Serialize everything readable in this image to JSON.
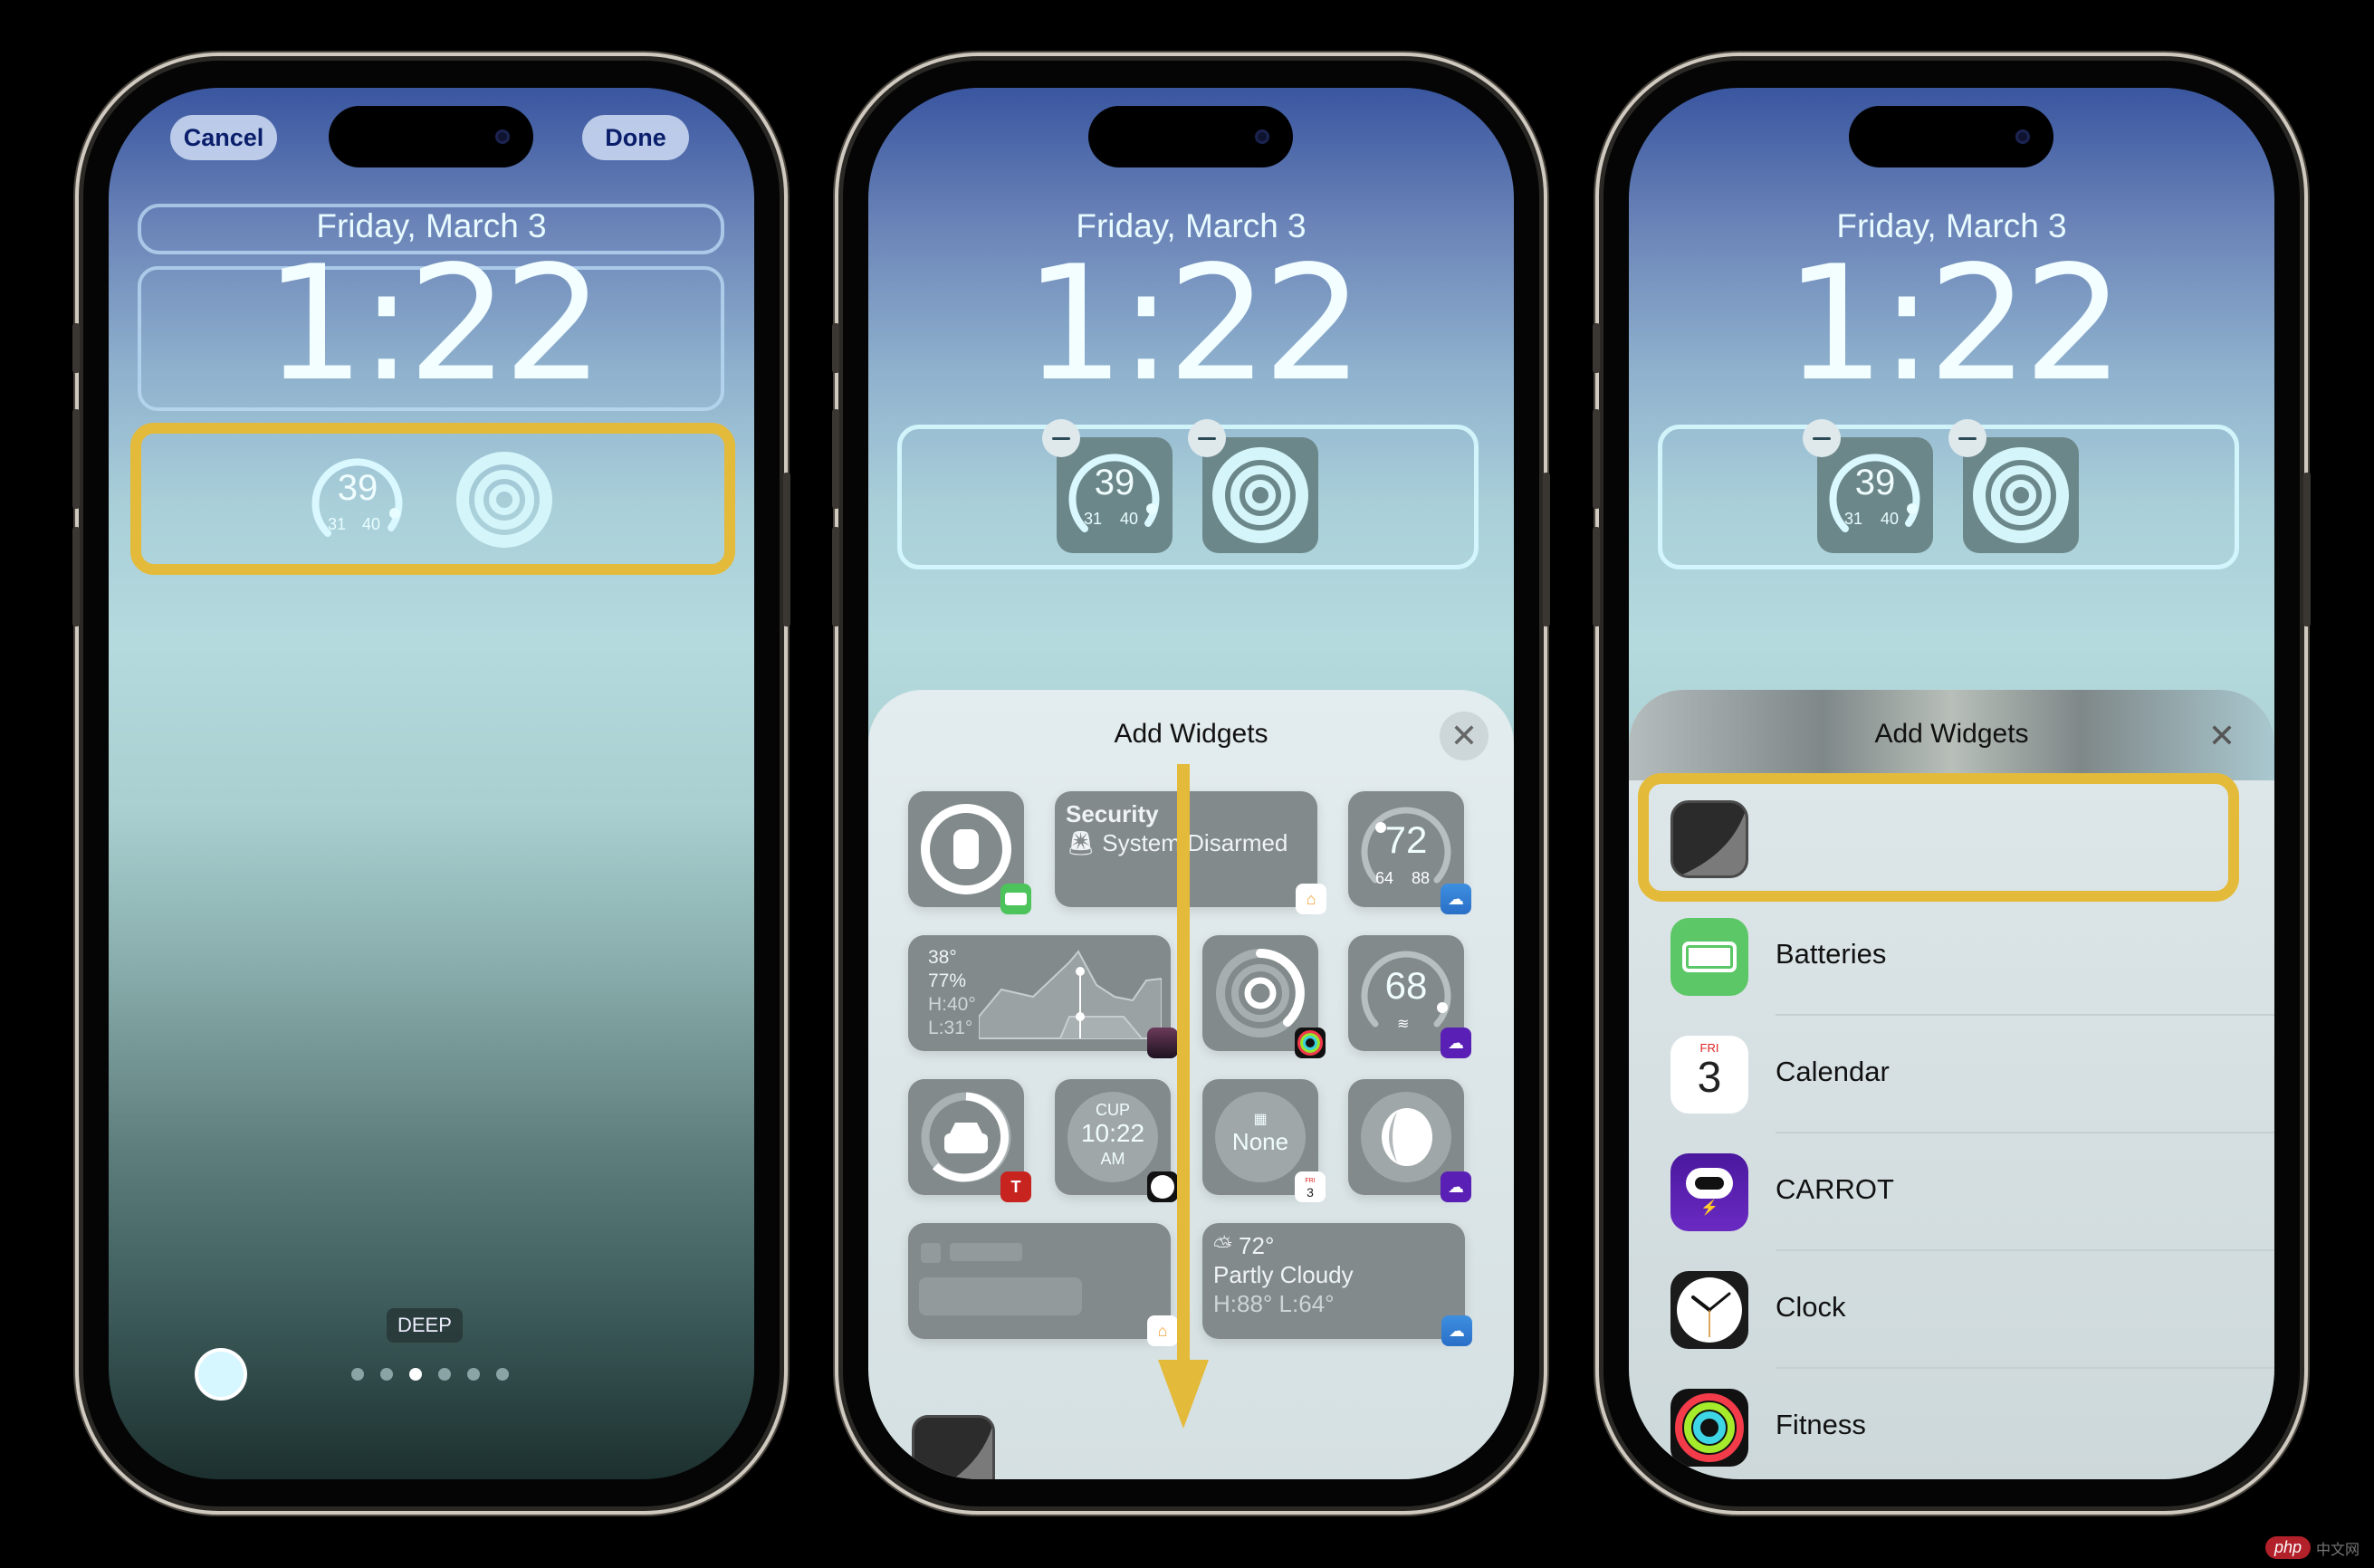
{
  "lockscreen": {
    "date": "Friday, March 3",
    "time": "1:22",
    "weather_gauge": {
      "current": "39",
      "low": "31",
      "high": "40"
    },
    "accent_highlight": "#e4ba3a"
  },
  "phone1": {
    "cancel_label": "Cancel",
    "done_label": "Done",
    "filter_label": "DEEP",
    "page_dots": {
      "count": 6,
      "active_index": 2
    }
  },
  "phone2": {
    "sheet_title": "Add Widgets",
    "close_icon": "close-icon",
    "widgets": {
      "battery": {
        "icon": "watch-icon",
        "app_badge": "batteries-badge"
      },
      "security": {
        "line1": "Security",
        "line2": "System Disarmed",
        "icon": "siren-icon",
        "app_badge": "home-badge"
      },
      "temp72": {
        "current": "72",
        "low": "64",
        "high": "88",
        "app_badge": "weather-badge"
      },
      "forecast": {
        "temp": "38°",
        "humidity": "77%",
        "high": "H:40°",
        "low": "L:31°",
        "app_badge": "photo-badge"
      },
      "activity": {
        "app_badge": "fitness-badge"
      },
      "wind68": {
        "current": "68",
        "app_badge": "carrot-badge"
      },
      "tesla": {
        "icon": "car-charging-icon",
        "app_badge": "tesla-badge"
      },
      "worldclock": {
        "city": "CUP",
        "time": "10:22",
        "ampm": "AM",
        "app_badge": "clock-badge"
      },
      "calendar": {
        "text": "None",
        "app_badge_day": "FRI",
        "app_badge_date": "3"
      },
      "moon": {
        "app_badge": "carrot-badge"
      },
      "home_placeholder": {
        "app_badge": "home-badge"
      },
      "weather_wide": {
        "temp": "72°",
        "condition": "Partly Cloudy",
        "range": "H:88° L:64°",
        "app_badge": "weather-badge"
      }
    }
  },
  "phone3": {
    "sheet_title": "Add Widgets",
    "apps": [
      {
        "label": "",
        "icon": "watch-faces-icon",
        "highlighted": true
      },
      {
        "label": "Batteries",
        "icon": "batteries-icon"
      },
      {
        "label": "Calendar",
        "icon": "calendar-icon",
        "icon_day": "FRI",
        "icon_date": "3"
      },
      {
        "label": "CARROT",
        "icon": "carrot-weather-icon"
      },
      {
        "label": "Clock",
        "icon": "clock-icon"
      },
      {
        "label": "Fitness",
        "icon": "fitness-icon"
      }
    ]
  },
  "watermark": {
    "text": "php",
    "suffix": "中文网"
  }
}
